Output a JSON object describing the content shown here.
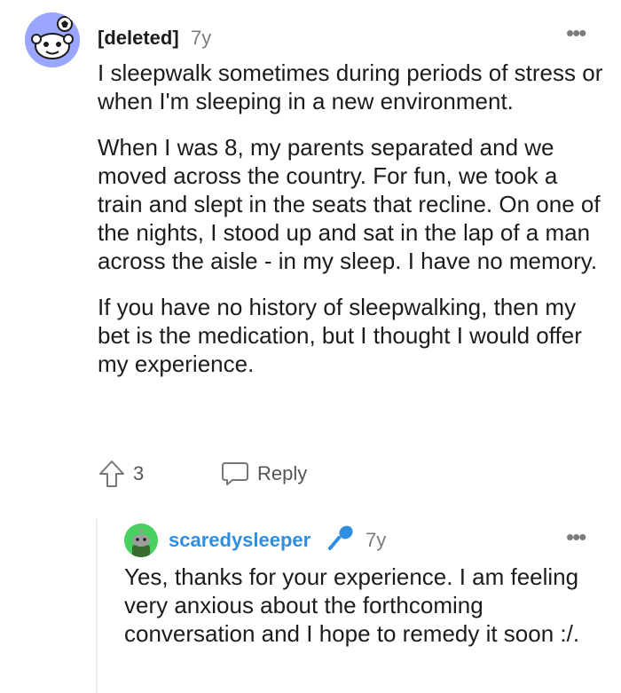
{
  "comment": {
    "username": "[deleted]",
    "age": "7y",
    "more_label": "•••",
    "paragraphs": [
      "I sleepwalk sometimes during periods of stress or when I'm sleeping in a new environment.",
      "When I was 8, my parents separated and we moved across the country. For fun, we took a train and slept in the seats that recline. On one of the nights, I stood up and sat in the lap of a man across the aisle - in my sleep. I have no memory.",
      "If you have no history of sleepwalking, then my bet is the medication, but I thought I would offer my experience."
    ],
    "votes": "3",
    "reply_label": "Reply"
  },
  "reply": {
    "username": "scaredysleeper",
    "age": "7y",
    "more_label": "•••",
    "text": "Yes, thanks for your experience. I am feeling very anxious about the forthcoming conversation and I hope to remedy it soon :/."
  },
  "colors": {
    "username_reply": "#2f8ee0",
    "avatar_main_bg": "#9aa6ff",
    "avatar_reply_bg": "#46d160",
    "meta_gray": "#7c7c7c"
  },
  "icons": [
    "snoo-avatar-icon",
    "upvote-arrow-icon",
    "chat-bubble-icon",
    "snoo-green-avatar-icon",
    "microphone-icon",
    "more-options-icon"
  ]
}
